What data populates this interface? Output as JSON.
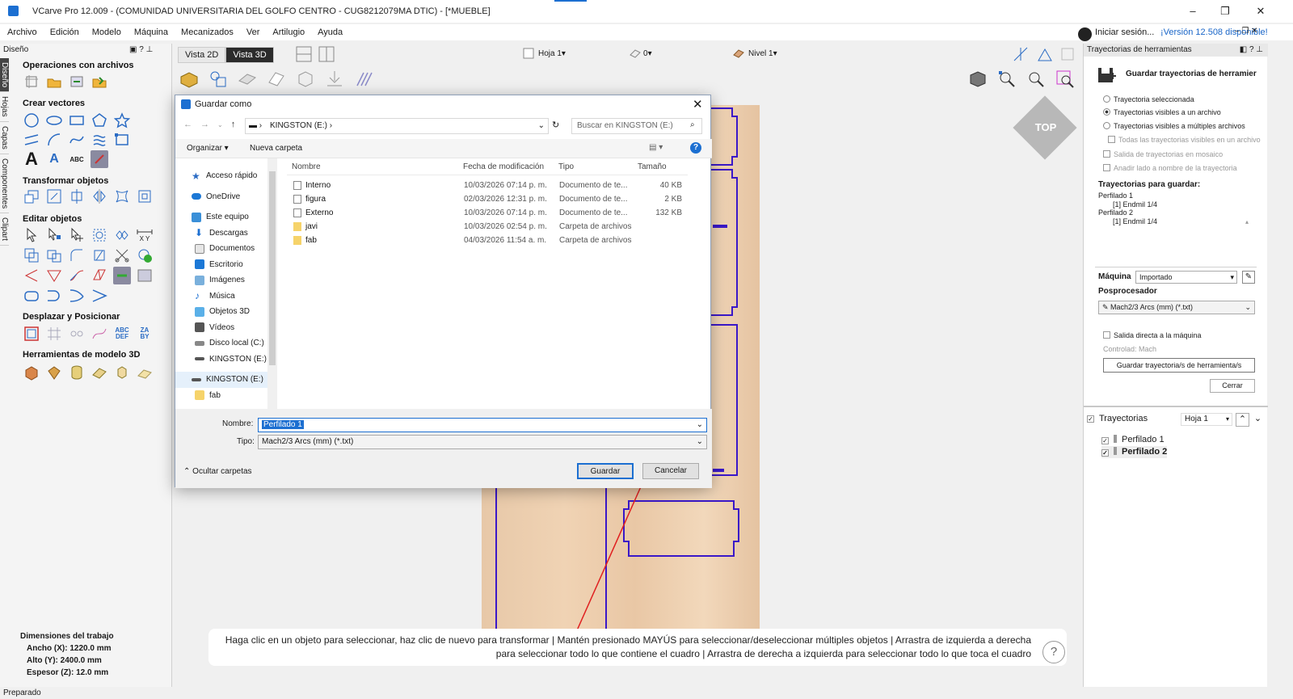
{
  "window": {
    "title": "VCarve Pro 12.009 - (COMUNIDAD UNIVERSITARIA DEL GOLFO CENTRO - CUG8212079MA DTIC) - [*MUEBLE]"
  },
  "menu": [
    "Archivo",
    "Edición",
    "Modelo",
    "Máquina",
    "Mecanizados",
    "Ver",
    "Artilugio",
    "Ayuda"
  ],
  "account": {
    "signin": "Iniciar sesión...",
    "version": "¡Versión 12.508 disponible!"
  },
  "left": {
    "panel_title": "Diseño",
    "side_tabs": [
      "Diseño",
      "Hojas",
      "Capas",
      "Componentes",
      "Clipart"
    ],
    "sections": [
      "Operaciones con archivos",
      "Crear vectores",
      "Transformar objetos",
      "Editar objetos",
      "Desplazar y Posicionar",
      "Herramientas de modelo 3D"
    ],
    "dims_title": "Dimensiones del trabajo",
    "dims": [
      "Ancho  (X): 1220.0 mm",
      "Alto   (Y): 2400.0 mm",
      "Espesor (Z): 12.0 mm"
    ]
  },
  "status": "Preparado",
  "view": {
    "tab2d": "Vista 2D",
    "tab3d": "Vista 3D",
    "sheet": "Hoja 1",
    "zero": "0",
    "level": "Nivel 1",
    "cube": "TOP",
    "hint": "Haga clic en un objeto para seleccionar, haz clic de nuevo para transformar | Mantén presionado MAYÚS para seleccionar/deseleccionar múltiples objetos | Arrastra de izquierda a derecha para seleccionar todo lo que contiene el cuadro | Arrastra de derecha a izquierda para seleccionar todo lo que toca el cuadro",
    "help": "?"
  },
  "dialog": {
    "title": "Guardar como",
    "address": "KINGSTON (E:)",
    "search_placeholder": "Buscar en KINGSTON (E:)",
    "organize": "Organizar",
    "new_folder": "Nueva carpeta",
    "nav": [
      "Acceso rápido",
      "OneDrive",
      "Este equipo",
      "Descargas",
      "Documentos",
      "Escritorio",
      "Imágenes",
      "Música",
      "Objetos 3D",
      "Vídeos",
      "Disco local (C:)",
      "KINGSTON (E:)",
      "KINGSTON (E:)",
      "fab"
    ],
    "columns": [
      "Nombre",
      "Fecha de modificación",
      "Tipo",
      "Tamaño"
    ],
    "files": [
      {
        "name": "Interno",
        "date": "10/03/2026 07:14 p. m.",
        "type": "Documento de te...",
        "size": "40 KB"
      },
      {
        "name": "figura",
        "date": "02/03/2026 12:31 p. m.",
        "type": "Documento de te...",
        "size": "2 KB"
      },
      {
        "name": "Externo",
        "date": "10/03/2026 07:14 p. m.",
        "type": "Documento de te...",
        "size": "132 KB"
      },
      {
        "name": "javi",
        "date": "10/03/2026 02:54 p. m.",
        "type": "Carpeta de archivos",
        "size": ""
      },
      {
        "name": "fab",
        "date": "04/03/2026 11:54 a. m.",
        "type": "Carpeta de archivos",
        "size": ""
      }
    ],
    "name_label": "Nombre:",
    "name_value": "Perfilado 1",
    "type_label": "Tipo:",
    "type_value": "Mach2/3 Arcs (mm) (*.txt)",
    "hide_folders": "Ocultar carpetas",
    "save": "Guardar",
    "cancel": "Cancelar"
  },
  "right": {
    "panel_title": "Trayectorias de herramientas",
    "save_title": "Guardar trayectorias de herramier",
    "opt1": "Trayectoria seleccionada",
    "opt2": "Trayectorias visibles a un archivo",
    "opt3": "Trayectorias visibles a múltiples archivos",
    "opt3a": "Todas las trayectorias visibles en un archivo",
    "opt4": "Salida de trayectorias en mosaico",
    "opt5": "Anadir lado a nombre de la trayectoria",
    "to_save_title": "Trayectorias para guardar:",
    "to_save": [
      "Perfilado 1",
      "[1] Endmil 1/4",
      "Perfilado 2",
      "[1] Endmil 1/4"
    ],
    "machine_label": "Máquina",
    "machine_value": "Importado",
    "post_label": "Posprocesador",
    "post_value": "Mach2/3 Arcs (mm) (*.txt)",
    "direct": "Salida directa a la máquina",
    "controlled": "Controlad: Mach",
    "save_btn": "Guardar trayectoria/s de herramienta/s",
    "close_btn": "Cerrar",
    "toolpaths_title": "Trayectorias",
    "toolpaths_sheet": "Hoja 1",
    "toolpaths": [
      "Perfilado 1",
      "Perfilado 2"
    ]
  }
}
